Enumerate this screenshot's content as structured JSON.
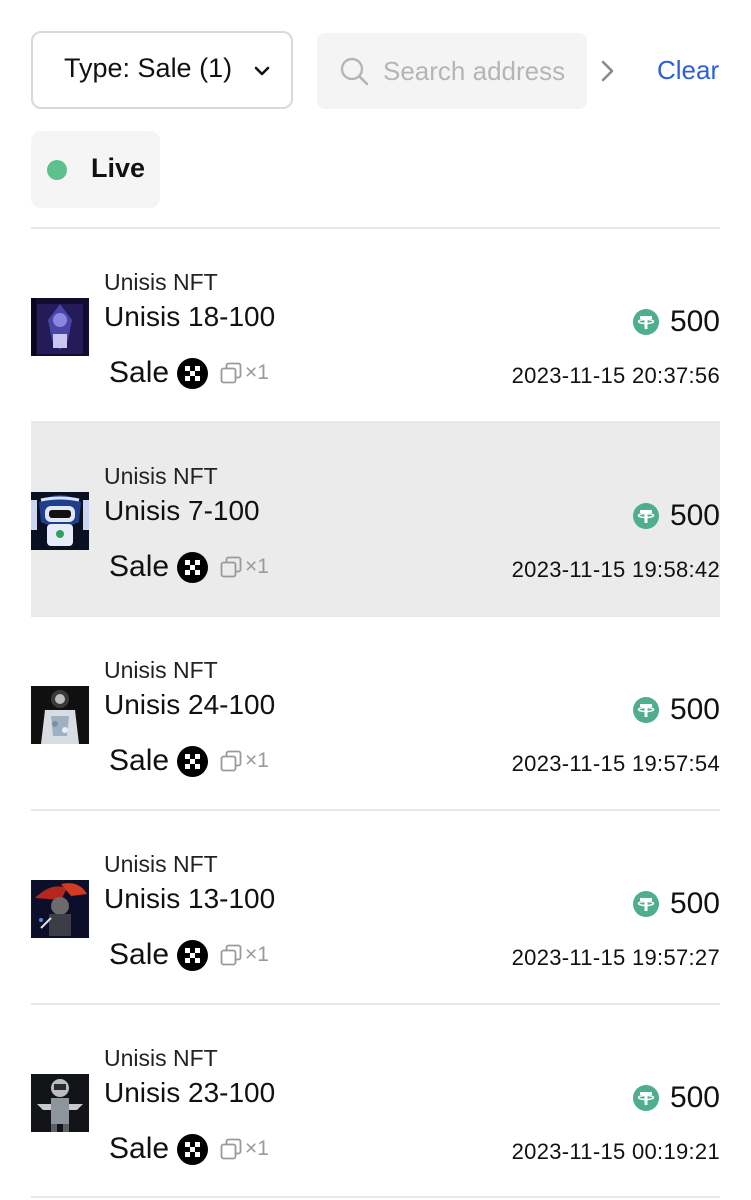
{
  "filters": {
    "type_select_label": "Type: Sale (1)",
    "search_placeholder": "Search address",
    "search_value": "",
    "clear_label": "Clear",
    "status_chip_label": "Live"
  },
  "colors": {
    "accent_link": "#2e5fd9",
    "live_dot": "#5cc18c",
    "usdt_green": "#4fae8c",
    "highlight_row": "#ebebeb"
  },
  "icons": {
    "dropdown": "chevron-down-icon",
    "search": "search-icon",
    "scroll": "chevron-right-icon",
    "currency": "usdt-icon",
    "marketplace": "okx-icon",
    "edition": "copy-icon"
  },
  "activity": [
    {
      "collection": "Unisis NFT",
      "name": "Unisis 18-100",
      "type": "Sale",
      "quantity": "×1",
      "price": "500",
      "timestamp": "2023-11-15 20:37:56",
      "highlighted": false
    },
    {
      "collection": "Unisis NFT",
      "name": "Unisis 7-100",
      "type": "Sale",
      "quantity": "×1",
      "price": "500",
      "timestamp": "2023-11-15 19:58:42",
      "highlighted": true
    },
    {
      "collection": "Unisis NFT",
      "name": "Unisis 24-100",
      "type": "Sale",
      "quantity": "×1",
      "price": "500",
      "timestamp": "2023-11-15 19:57:54",
      "highlighted": false
    },
    {
      "collection": "Unisis NFT",
      "name": "Unisis 13-100",
      "type": "Sale",
      "quantity": "×1",
      "price": "500",
      "timestamp": "2023-11-15 19:57:27",
      "highlighted": false
    },
    {
      "collection": "Unisis NFT",
      "name": "Unisis 23-100",
      "type": "Sale",
      "quantity": "×1",
      "price": "500",
      "timestamp": "2023-11-15 00:19:21",
      "highlighted": false
    }
  ]
}
